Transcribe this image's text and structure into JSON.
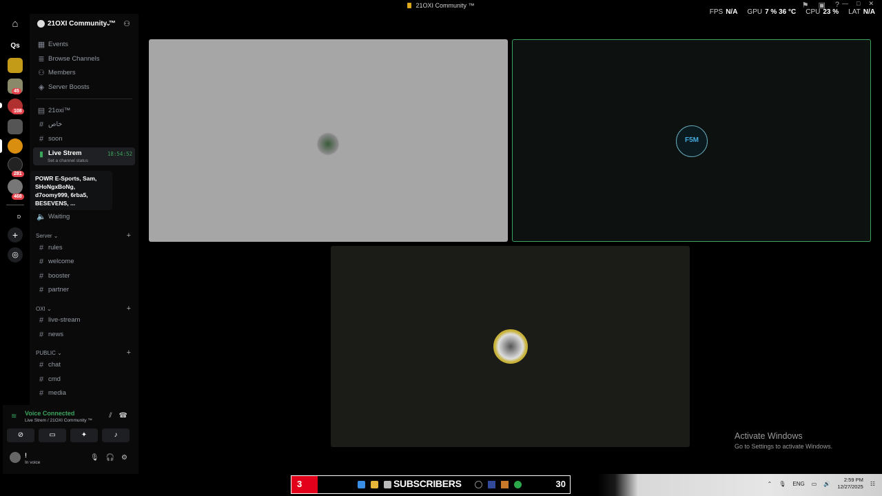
{
  "window": {
    "title": "21OXI Community ™",
    "stats": [
      {
        "label": "FPS",
        "value": "N/A"
      },
      {
        "label": "GPU",
        "value": "7 %  36 °C"
      },
      {
        "label": "CPU",
        "value": "23 %"
      },
      {
        "label": "LAT",
        "value": "N/A"
      }
    ]
  },
  "rail": {
    "home_label": "Qs",
    "badges": [
      "45",
      "108",
      "281",
      "468"
    ],
    "d_label": "D"
  },
  "server": {
    "name": "21OXI Community ™",
    "top_items": [
      {
        "icon": "calendar-icon",
        "label": "Events"
      },
      {
        "icon": "browse-icon",
        "label": "Browse Channels"
      },
      {
        "icon": "members-icon",
        "label": "Members"
      },
      {
        "icon": "boost-icon",
        "label": "Server Boosts"
      }
    ],
    "channels_a": [
      {
        "icon": "rules-icon",
        "label": "21oxi™"
      },
      {
        "icon": "hash-icon",
        "label": "خاص"
      },
      {
        "icon": "hash-icon",
        "label": "soon"
      }
    ],
    "live": {
      "label": "Live Strem",
      "time": "18:54:52",
      "status": "Set a channel status"
    },
    "tooltip": "POWR E-Sports, Sam, SHoNgxBoNg, d7oomy999, 6rba5, BESEVENS, ...",
    "waiting": "Waiting",
    "categories": [
      {
        "name": "Server",
        "channels": [
          "rules",
          "welcome",
          "booster",
          "partner"
        ]
      },
      {
        "name": "OXI",
        "channels": [
          "live-stream",
          "news"
        ]
      },
      {
        "name": "PUBLIC",
        "channels": [
          "chat",
          "cmd",
          "media"
        ]
      }
    ]
  },
  "voice": {
    "status": "Voice Connected",
    "location": "Live Strem / 21OXI Community ™",
    "user_name": "!",
    "user_status": "In voice"
  },
  "stage": {
    "tile2_logo": "F5M"
  },
  "watermark": {
    "line1": "Activate Windows",
    "line2": "Go to Settings to activate Windows."
  },
  "taskbar": {
    "sub_count": "3",
    "sub_label": "SUBSCRIBERS",
    "sub_goal": "30",
    "lang": "ENG",
    "time": "2:59 PM",
    "date": "12/27/2025"
  }
}
